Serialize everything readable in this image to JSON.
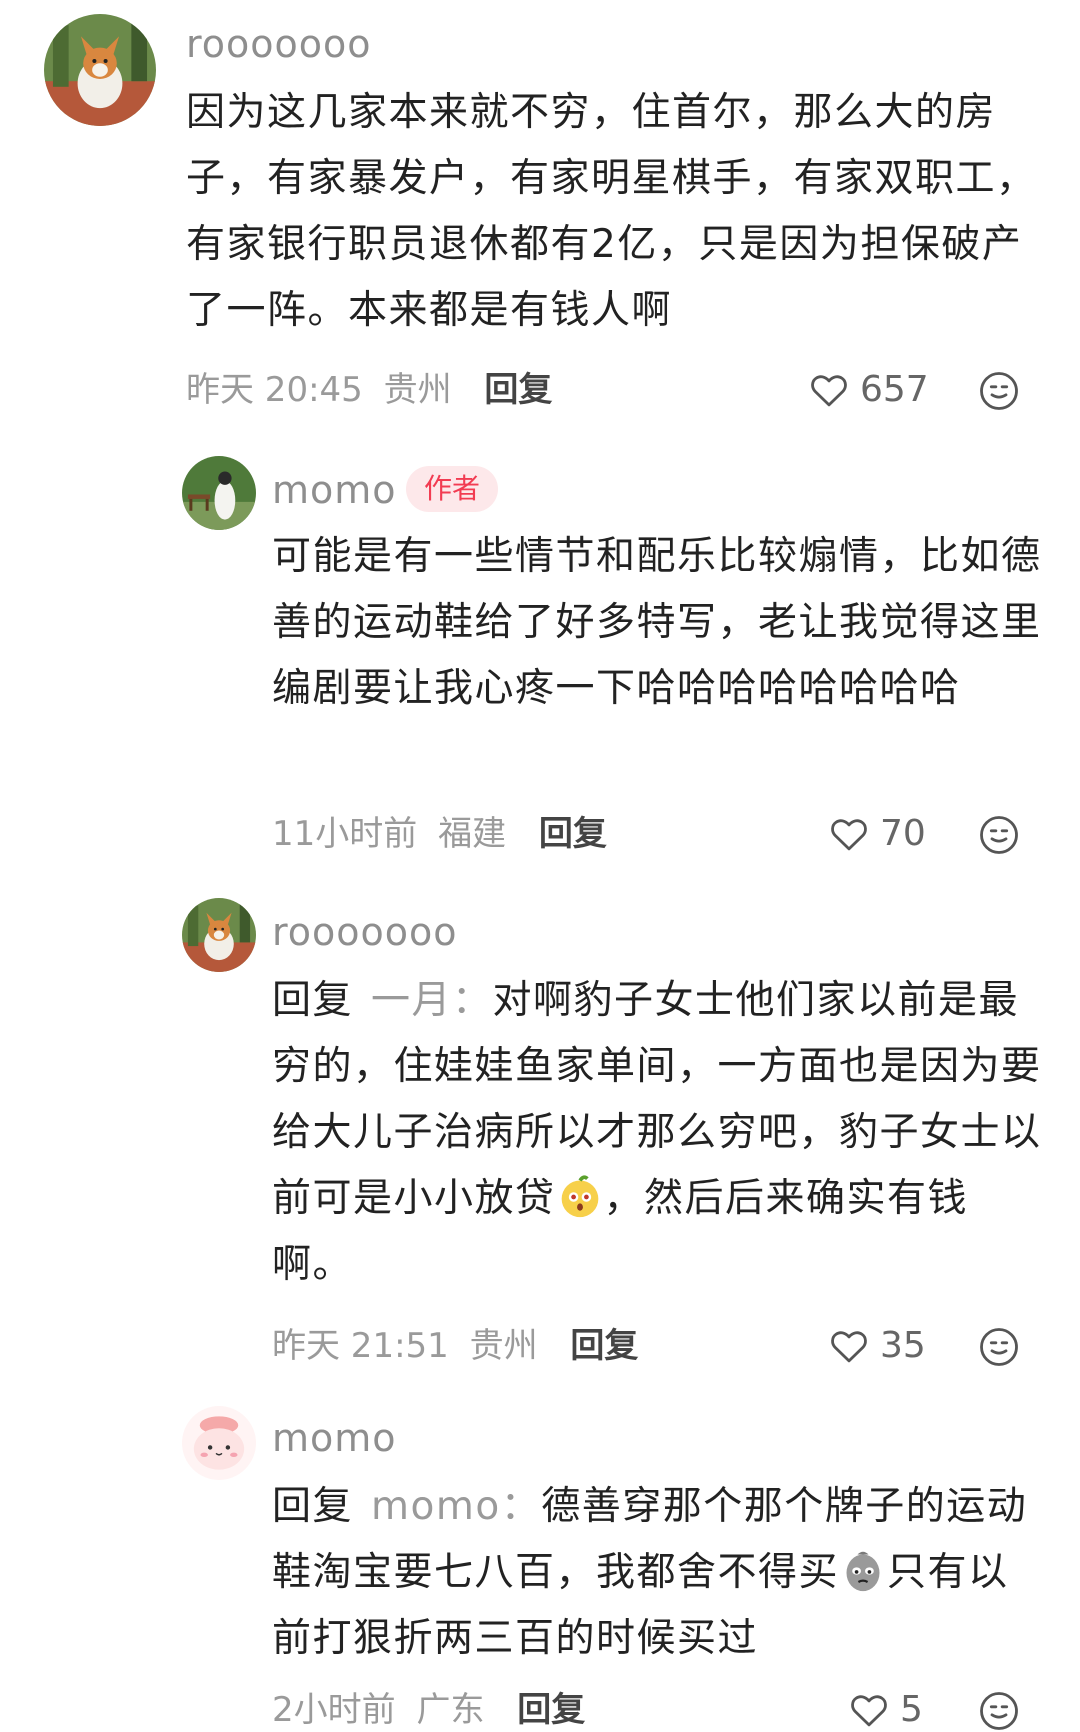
{
  "comments": [
    {
      "username": "rooooooo",
      "text": "因为这几家本来就不穷，住首尔，那么大的房子，有家暴发户，有家明星棋手，有家双职工，有家银行职员退休都有2亿，只是因为担保破产了一阵。本来都是有钱人啊",
      "time": "昨天 20:45",
      "location": "贵州",
      "reply_label": "回复",
      "likes": "657",
      "like_icon": "heart-outline-icon",
      "react_icon": "smiley-face-icon"
    },
    {
      "username": "momo",
      "badge": "作者",
      "text": "可能是有一些情节和配乐比较煽情，比如德善的运动鞋给了好多特写，老让我觉得这里编剧要让我心疼一下哈哈哈哈哈哈哈哈",
      "time": "11小时前",
      "location": "福建",
      "reply_label": "回复",
      "likes": "70"
    },
    {
      "username": "rooooooo",
      "reply_prefix": "回复",
      "reply_target": "一月：",
      "text_a": "对啊豹子女士他们家以前是最穷的，住娃娃鱼家单间，一方面也是因为要给大儿子治病所以才那么穷吧，豹子女士以前可是小小放贷",
      "emoji_a": "surprised-face-emoji",
      "text_b": "，然后后来确实有钱啊。",
      "time": "昨天 21:51",
      "location": "贵州",
      "reply_label": "回复",
      "likes": "35"
    },
    {
      "username": "momo",
      "reply_prefix": "回复",
      "reply_target": "momo：",
      "text_a": "德善穿那个那个牌子的运动鞋淘宝要七八百，我都舍不得买",
      "emoji_a": "sad-face-emoji",
      "text_b": "只有以前打狠折两三百的时候买过",
      "time": "2小时前",
      "location": "广东",
      "reply_label": "回复",
      "likes": "5"
    }
  ]
}
